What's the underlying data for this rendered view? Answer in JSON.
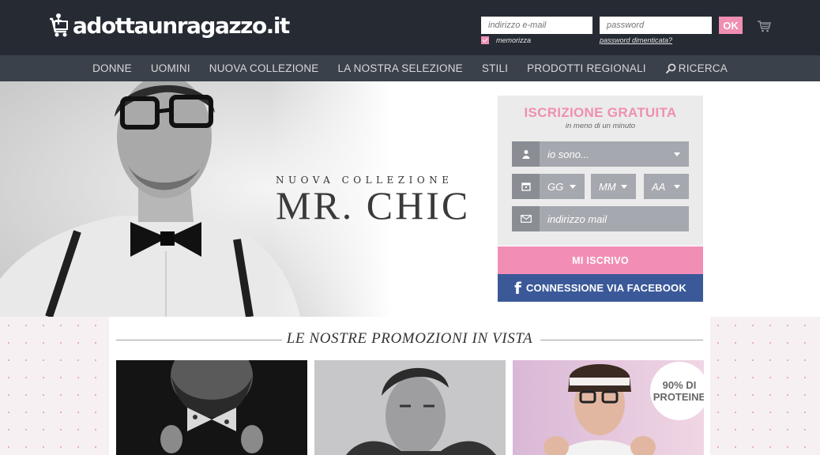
{
  "header": {
    "logo_text": "adottaunragazzo.it",
    "email_placeholder": "indirizzo e-mail",
    "password_placeholder": "password",
    "ok_label": "OK",
    "remember_label": "memorizza",
    "forgot_label": "password dimenticata?",
    "cart_icon": "cart-icon"
  },
  "nav": {
    "items": [
      "DONNE",
      "UOMINI",
      "NUOVA COLLEZIONE",
      "LA NOSTRA SELEZIONE",
      "STILI",
      "PRODOTTI REGIONALI"
    ],
    "search_label": "RICERCA"
  },
  "hero": {
    "collection_subtitle": "NUOVA COLLEZIONE",
    "collection_title": "MR. CHIC"
  },
  "signup": {
    "title": "ISCRIZIONE GRATUITA",
    "subtitle": "in meno di un minuto",
    "gender_placeholder": "io sono...",
    "day_label": "GG",
    "month_label": "MM",
    "year_label": "AA",
    "email_placeholder": "indirizzo mail",
    "submit_label": "MI ISCRIVO",
    "facebook_label": "CONNESSIONE VIA FACEBOOK"
  },
  "promotions": {
    "heading": "LE NOSTRE PROMOZIONI IN VISTA",
    "badge_line1": "90% DI",
    "badge_line2": "PROTEINE"
  },
  "colors": {
    "topbar": "#252a33",
    "nav": "#3b414b",
    "pink": "#ef8fb2",
    "facebook": "#3b5999"
  }
}
